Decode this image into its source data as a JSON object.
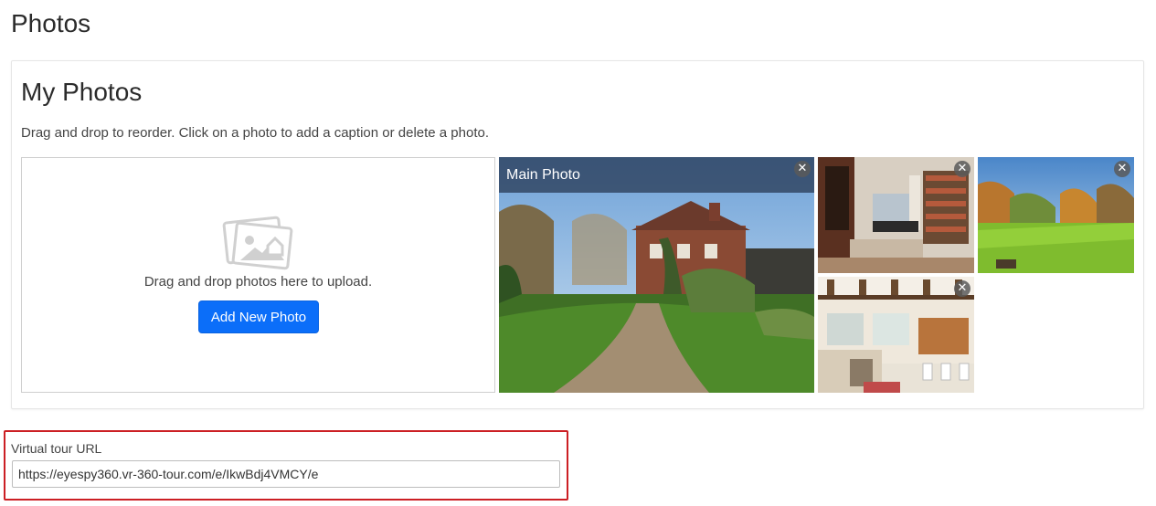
{
  "page": {
    "title": "Photos"
  },
  "my_photos": {
    "title": "My Photos",
    "instructions": "Drag and drop to reorder. Click on a photo to add a caption or delete a photo.",
    "dropzone": {
      "icon": "photos-icon",
      "text": "Drag and drop photos here to upload.",
      "add_button_label": "Add New Photo"
    },
    "photos": [
      {
        "caption": "Main Photo",
        "scene": "house-exterior-driveway",
        "close_icon": "close-icon",
        "close_glyph": "✕"
      },
      {
        "scene": "living-room-bookshelves",
        "close_icon": "close-icon",
        "close_glyph": "✕"
      },
      {
        "scene": "garden-lawn-trees",
        "close_icon": "close-icon",
        "close_glyph": "✕"
      },
      {
        "scene": "kitchen-dining-beams",
        "close_icon": "close-icon",
        "close_glyph": "✕"
      }
    ]
  },
  "virtual_tour": {
    "label": "Virtual tour URL",
    "value": "https://eyespy360.vr-360-tour.com/e/IkwBdj4VMCY/e"
  },
  "colors": {
    "primary_button": "#0b6ef9",
    "highlight_border": "#cc1f24",
    "caption_overlay": "#283a54"
  }
}
